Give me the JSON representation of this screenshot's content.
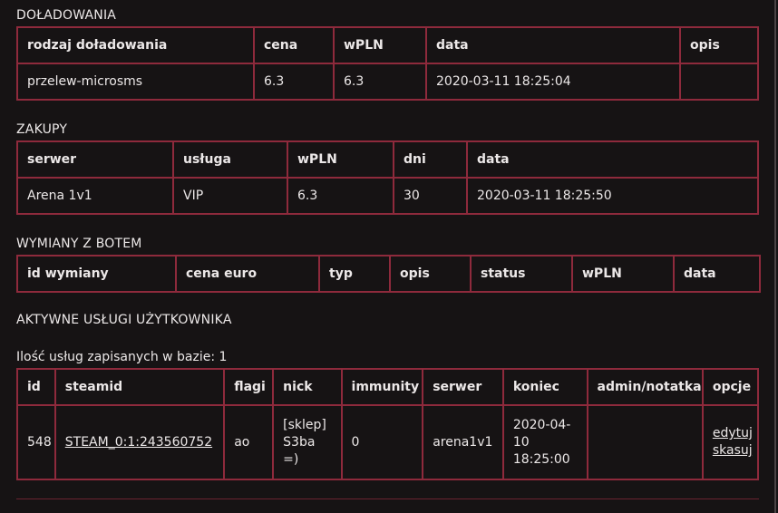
{
  "recharges": {
    "title": "DOŁADOWANIA",
    "headers": [
      "rodzaj doładowania",
      "cena",
      "wPLN",
      "data",
      "opis"
    ],
    "rows": [
      [
        "przelew-microsms",
        "6.3",
        "6.3",
        "2020-03-11 18:25:04",
        ""
      ]
    ]
  },
  "purchases": {
    "title": "ZAKUPY",
    "headers": [
      "serwer",
      "usługa",
      "wPLN",
      "dni",
      "data"
    ],
    "rows": [
      [
        "Arena 1v1",
        "VIP",
        "6.3",
        "30",
        "2020-03-11 18:25:50"
      ]
    ]
  },
  "bot_exchanges": {
    "title": "WYMIANY Z BOTEM",
    "headers": [
      "id wymiany",
      "cena euro",
      "typ",
      "opis",
      "status",
      "wPLN",
      "data"
    ]
  },
  "active_services": {
    "title": "AKTYWNE USŁUGI UŻYTKOWNIKA",
    "count_text": "Ilość usług zapisanych w bazie: 1",
    "headers": [
      "id",
      "steamid",
      "flagi",
      "nick",
      "immunity",
      "serwer",
      "koniec",
      "admin/notatka",
      "opcje"
    ],
    "rows": [
      {
        "id": "548",
        "steamid": "STEAM_0:1:243560752",
        "flagi": "ao",
        "nick": "[sklep] S3ba =)",
        "immunity": "0",
        "serwer": "arena1v1",
        "koniec": "2020-04-10 18:25:00",
        "admin_note": "",
        "edit_label": "edytuj",
        "delete_label": "skasuj"
      }
    ]
  },
  "colors": {
    "background": "#161314",
    "border": "#8e2a3c",
    "text": "#ece8e8"
  }
}
